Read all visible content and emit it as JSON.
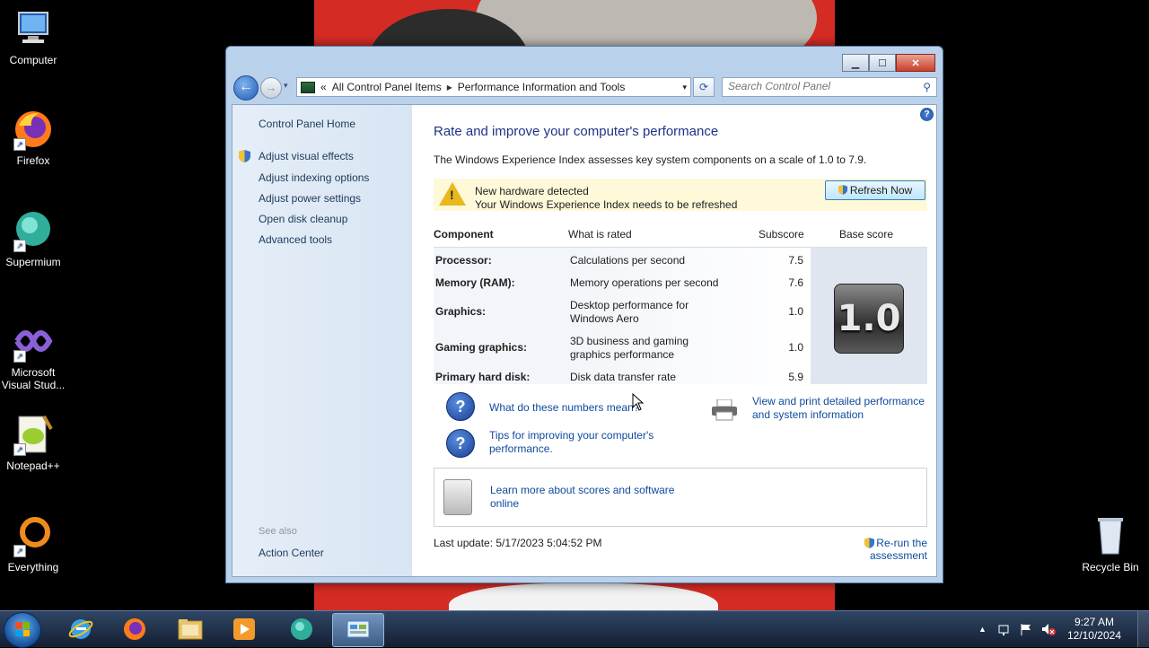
{
  "desktop_icons": [
    {
      "label": "Computer",
      "icon": "computer-icon"
    },
    {
      "label": "Firefox",
      "icon": "firefox-icon"
    },
    {
      "label": "Supermium",
      "icon": "supermium-icon"
    },
    {
      "label": "Microsoft Visual Stud...",
      "icon": "visual-studio-icon"
    },
    {
      "label": "Notepad++",
      "icon": "notepadpp-icon"
    },
    {
      "label": "Everything",
      "icon": "everything-icon"
    },
    {
      "label": "Recycle Bin",
      "icon": "recycle-bin-icon"
    }
  ],
  "window": {
    "caption": {
      "minimize": "▁",
      "maximize": "☐",
      "close": "✕"
    },
    "nav": {
      "back": "←",
      "forward": "→",
      "recent": "▾",
      "refresh": "⟳"
    },
    "address": {
      "overflow": "«",
      "crumbs": [
        "All Control Panel Items",
        "Performance Information and Tools"
      ],
      "sep": "▸",
      "dropdown": "▾"
    },
    "search": {
      "placeholder": "Search Control Panel",
      "icon": "⚲"
    }
  },
  "sidebar": {
    "home": "Control Panel Home",
    "items": [
      "Adjust visual effects",
      "Adjust indexing options",
      "Adjust power settings",
      "Open disk cleanup",
      "Advanced tools"
    ],
    "see_also_label": "See also",
    "see_also_items": [
      "Action Center"
    ]
  },
  "main": {
    "help": "?",
    "title": "Rate and improve your computer's performance",
    "description": "The Windows Experience Index assesses key system components on a scale of 1.0 to 7.9.",
    "banner": {
      "icon": "warning-icon",
      "mark": "!",
      "line1": "New hardware detected",
      "line2": "Your Windows Experience Index needs to be refreshed",
      "button": "Refresh Now"
    },
    "table": {
      "headers": {
        "component": "Component",
        "what": "What is rated",
        "subscore": "Subscore",
        "base": "Base score"
      },
      "rows": [
        {
          "component": "Processor:",
          "what": "Calculations per second",
          "subscore": "7.5"
        },
        {
          "component": "Memory (RAM):",
          "what": "Memory operations per second",
          "subscore": "7.6"
        },
        {
          "component": "Graphics:",
          "what": "Desktop performance for Windows Aero",
          "subscore": "1.0"
        },
        {
          "component": "Gaming graphics:",
          "what": "3D business and gaming graphics performance",
          "subscore": "1.0"
        },
        {
          "component": "Primary hard disk:",
          "what": "Disk data transfer rate",
          "subscore": "5.9"
        }
      ],
      "base_score": "1.0"
    },
    "help_links": [
      {
        "icon": "question-icon",
        "mark": "?",
        "text": "What do these numbers mean?"
      },
      {
        "icon": "question-icon",
        "mark": "?",
        "text": "Tips for improving your computer's performance."
      }
    ],
    "print_link": "View and print detailed performance and system information",
    "learn_link": "Learn more about scores and software online",
    "last_update": "Last update: 5/17/2023 5:04:52 PM",
    "rerun": "Re-run the assessment"
  },
  "taskbar": {
    "items": [
      "internet-explorer-icon",
      "firefox-icon",
      "file-explorer-icon",
      "media-player-icon",
      "supermium-icon",
      "control-panel-icon"
    ],
    "tray_chevron": "▲",
    "time": "9:27 AM",
    "date": "12/10/2024"
  },
  "colors": {
    "link": "#0d4a9c",
    "title": "#1e3287",
    "banner": "#fdf9d9",
    "frame": "#b9d1ea"
  }
}
